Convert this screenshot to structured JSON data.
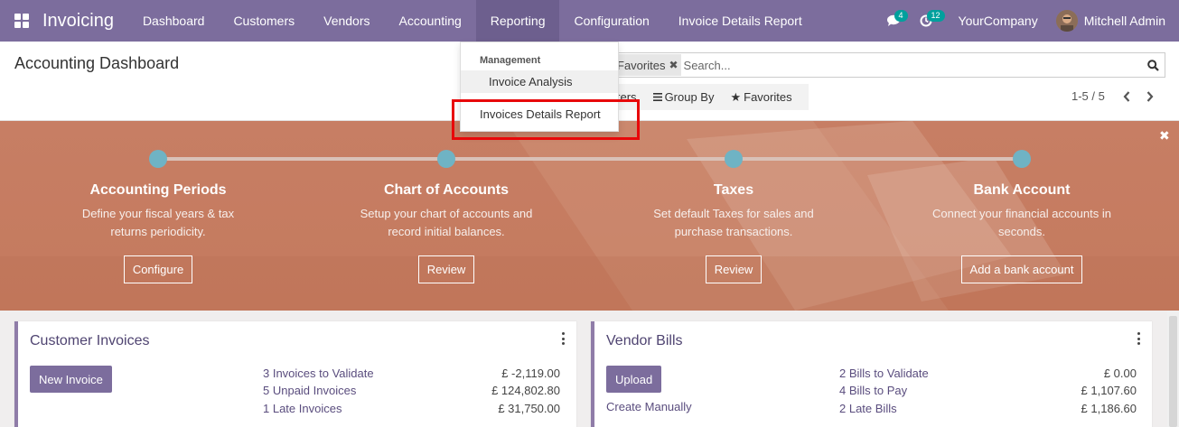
{
  "navbar": {
    "brand": "Invoicing",
    "menu": [
      "Dashboard",
      "Customers",
      "Vendors",
      "Accounting",
      "Reporting",
      "Configuration",
      "Invoice Details Report"
    ],
    "messages_count": "4",
    "activities_count": "12",
    "company": "YourCompany",
    "user": "Mitchell Admin"
  },
  "control_panel": {
    "title": "Accounting Dashboard",
    "facet_label": "Favorites",
    "search_placeholder": "Search...",
    "filters_label": "lters",
    "groupby_label": "Group By",
    "favorites_label": "Favorites",
    "pager": "1-5 / 5"
  },
  "dropdown": {
    "header": "Management",
    "items": [
      "Invoice Analysis",
      "Invoices Details Report"
    ]
  },
  "banner": {
    "steps": [
      {
        "title": "Accounting Periods",
        "desc1": "Define your fiscal years & tax",
        "desc2": "returns periodicity.",
        "button": "Configure"
      },
      {
        "title": "Chart of Accounts",
        "desc1": "Setup your chart of accounts and",
        "desc2": "record initial balances.",
        "button": "Review"
      },
      {
        "title": "Taxes",
        "desc1": "Set default Taxes for sales and",
        "desc2": "purchase transactions.",
        "button": "Review"
      },
      {
        "title": "Bank Account",
        "desc1": "Connect your financial accounts in",
        "desc2": "seconds.",
        "button": "Add a bank account"
      }
    ]
  },
  "cards": {
    "customer": {
      "title": "Customer Invoices",
      "button": "New Invoice",
      "stats": [
        {
          "label": "3 Invoices to Validate",
          "value": "£ -2,119.00"
        },
        {
          "label": "5 Unpaid Invoices",
          "value": "£ 124,802.80"
        },
        {
          "label": "1 Late Invoices",
          "value": "£ 31,750.00"
        }
      ]
    },
    "vendor": {
      "title": "Vendor Bills",
      "button": "Upload",
      "link": "Create Manually",
      "stats": [
        {
          "label": "2 Bills to Validate",
          "value": "£ 0.00"
        },
        {
          "label": "4 Bills to Pay",
          "value": "£ 1,107.60"
        },
        {
          "label": "2 Late Bills",
          "value": "£ 1,186.60"
        }
      ]
    }
  },
  "colors": {
    "navbar": "#7c6d9d",
    "banner": "#c77e64",
    "step_dot": "#6fb3c4",
    "badge": "#00a09d",
    "highlight": "#e8080a"
  }
}
